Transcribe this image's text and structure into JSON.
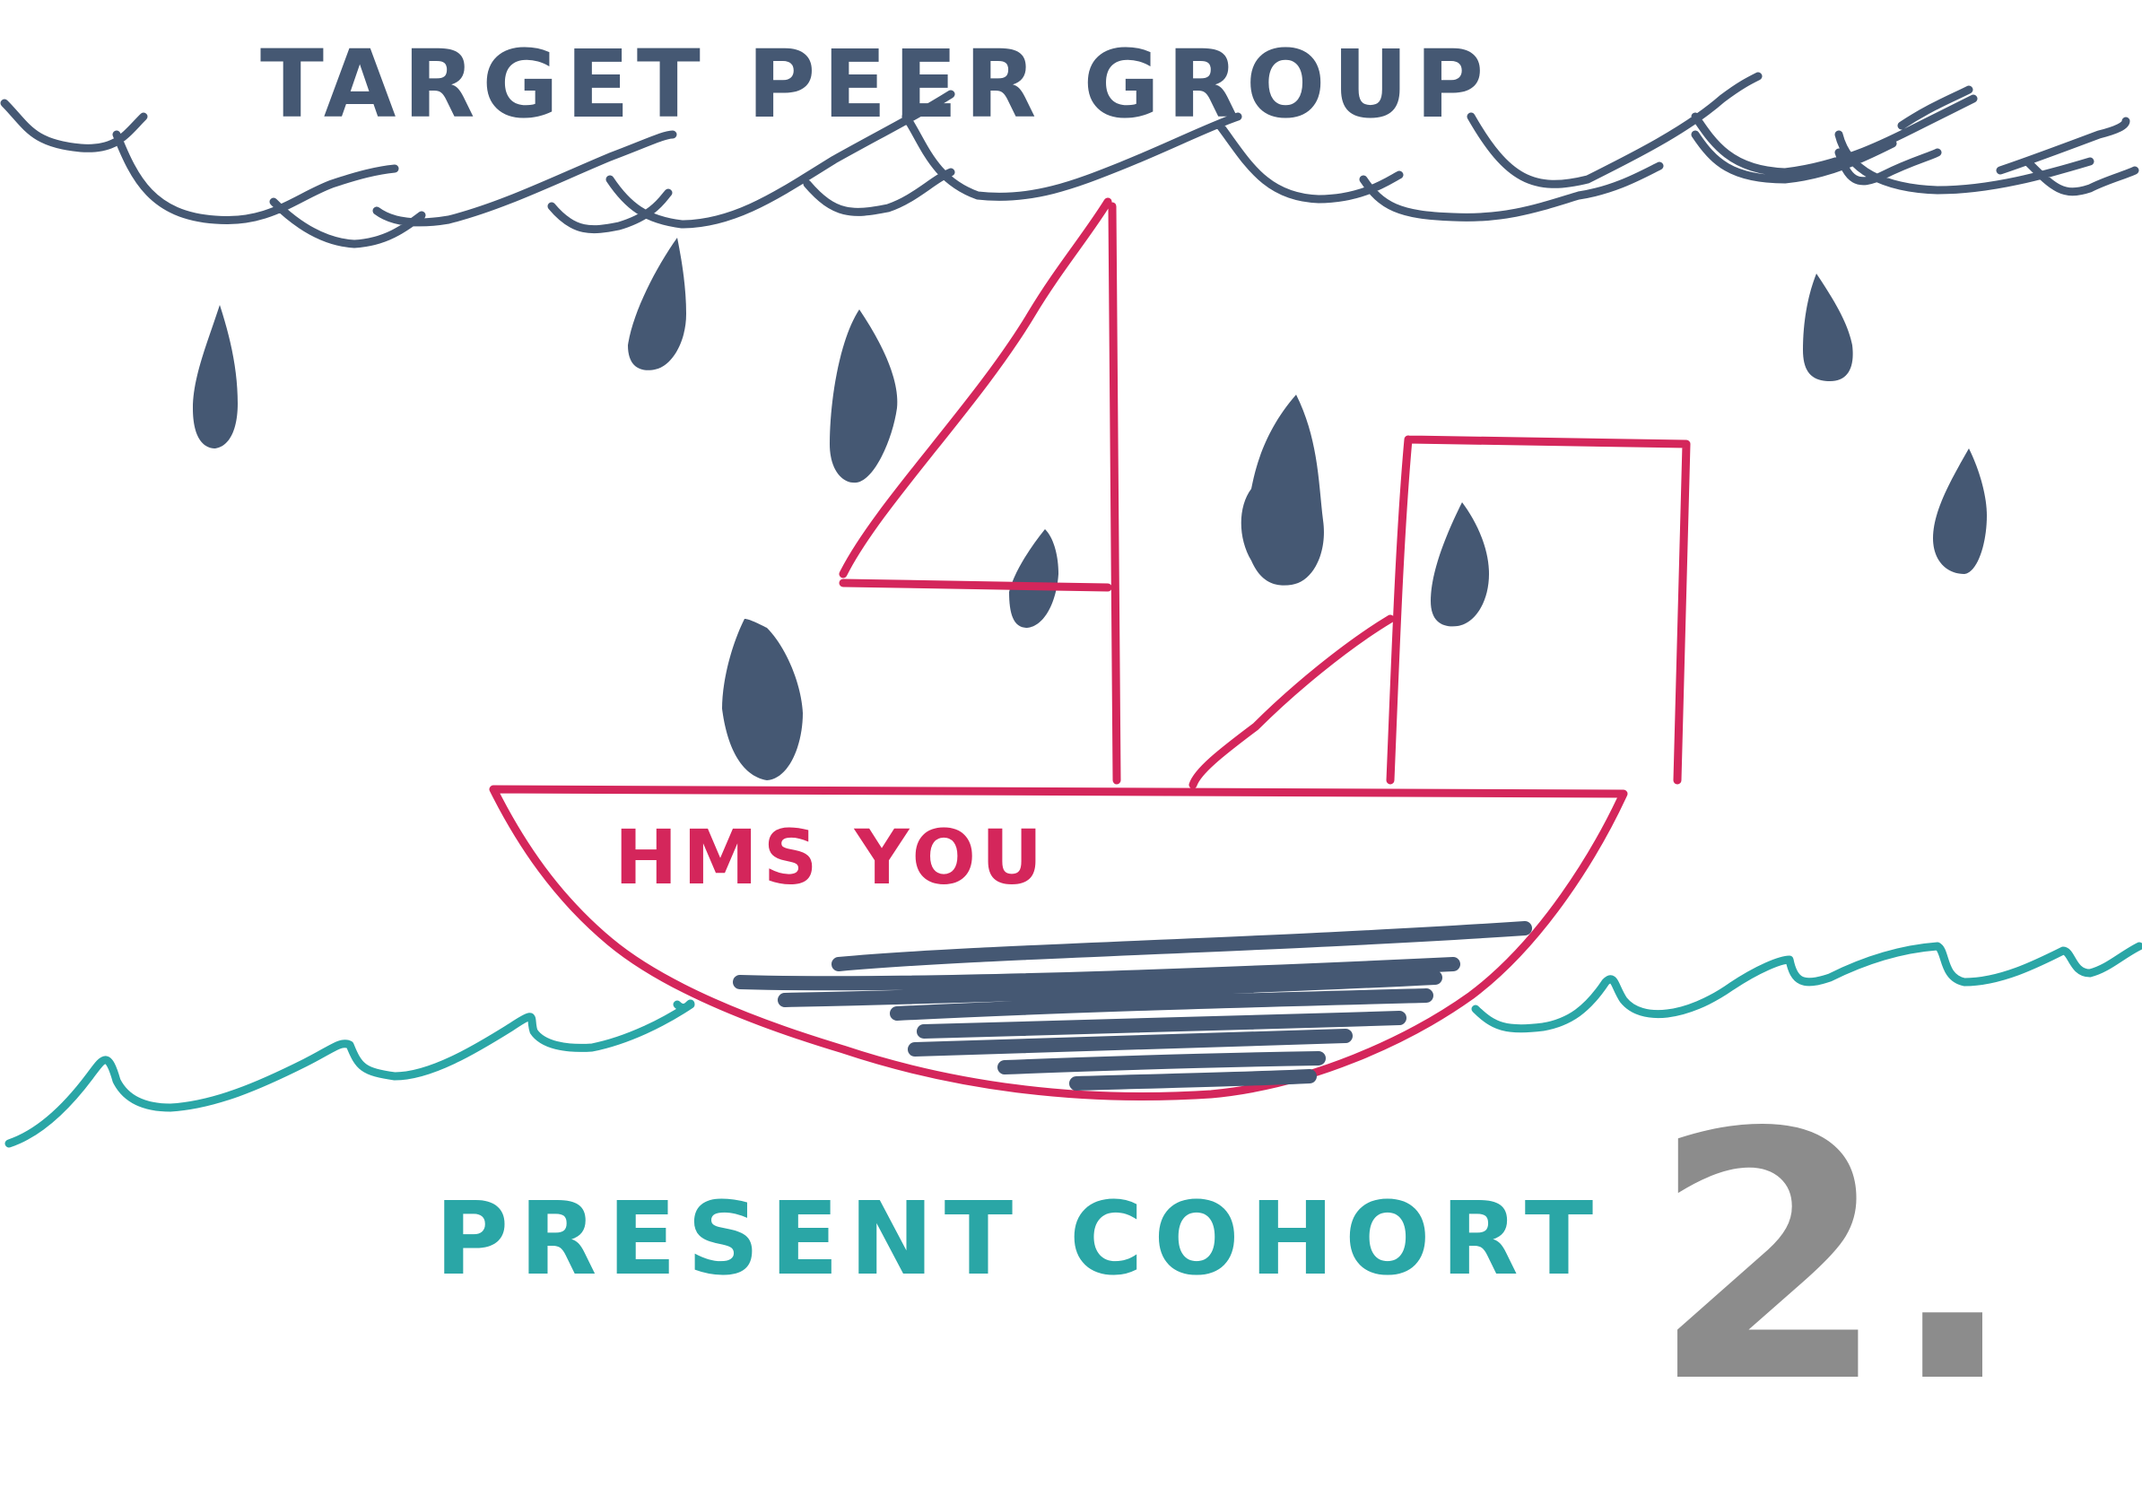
{
  "drawing": {
    "top_caption": "TARGET PEER GROUP",
    "boat_label": "HMS YOU",
    "bottom_caption": "PRESENT COHORT",
    "page_number": "2."
  },
  "colors": {
    "cloud": "#455873",
    "rain": "#455873",
    "boat": "#d4265b",
    "sea": "#2aa6a6",
    "hull_scribble": "#455873",
    "page_number": "#8c8c8c",
    "background": "#ffffff"
  },
  "icons": {
    "cloud": "raincloud",
    "boat": "sailboat",
    "rain": "raindrops",
    "sea": "waves"
  }
}
